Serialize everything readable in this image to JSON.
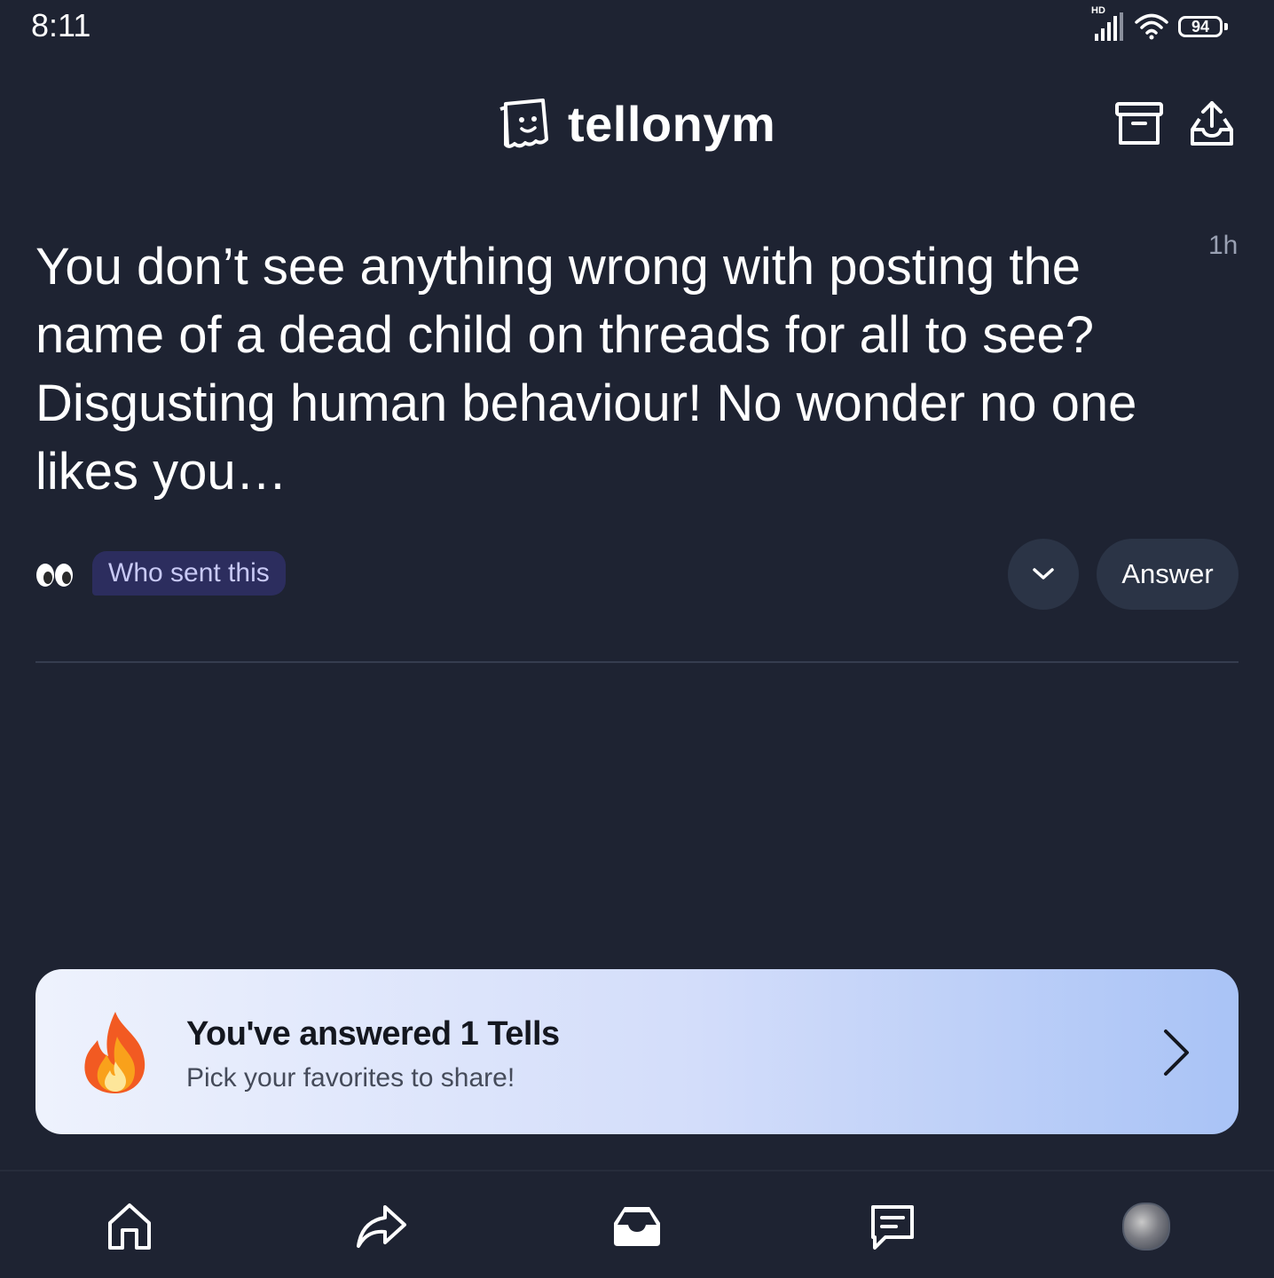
{
  "status_bar": {
    "time": "8:11",
    "network_label": "HD",
    "battery": "94"
  },
  "header": {
    "app_name": "tellonym",
    "icons": [
      "logo-icon",
      "archive-icon",
      "share-upload-icon"
    ]
  },
  "tell": {
    "text": "You don’t see anything wrong with posting the name of a dead child on threads for all to see? Disgusting human behaviour! No wonder no one likes you…",
    "time_ago": "1h",
    "who_sent_label": "Who sent this",
    "answer_label": "Answer",
    "icons": [
      "eyes-icon",
      "chevron-down-icon"
    ]
  },
  "banner": {
    "title": "You've answered 1 Tells",
    "subtitle": "Pick your favorites to share!",
    "icons": [
      "fire-icon",
      "chevron-right-icon"
    ]
  },
  "bottom_nav": {
    "items": [
      "home",
      "share",
      "inbox",
      "chats",
      "profile"
    ],
    "active": "inbox"
  },
  "colors": {
    "background": "#1e2332",
    "button_bg": "#2b3446",
    "who_sent_bg": "#2c2d5e",
    "banner_gradient_start": "#eef2fd",
    "banner_gradient_end": "#a9c3f6"
  }
}
